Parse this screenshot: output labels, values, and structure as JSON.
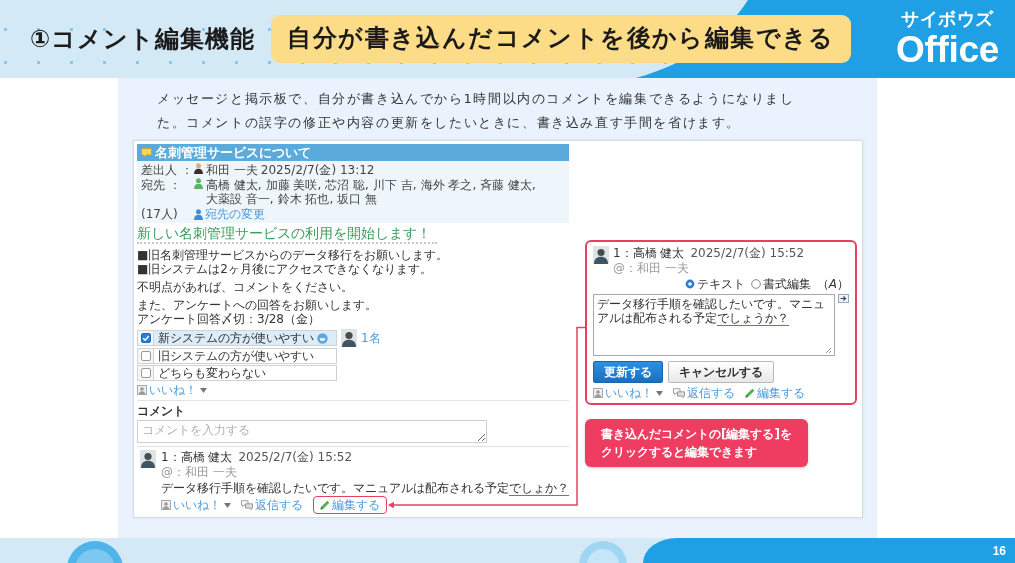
{
  "header": {
    "title": "①コメント編集機能",
    "headline": "自分が書き込んだコメントを後から編集できる",
    "logo": [
      "サイボウズ",
      "Office"
    ]
  },
  "intro": "メッセージと掲示板で、自分が書き込んでから1時間以内のコメントを編集できるようになりました。コメントの誤字の修正や内容の更新をしたいときに、書き込み直す手間を省けます。",
  "message": {
    "subject": "名刺管理サービスについて",
    "sender_label": "差出人 ：",
    "sender": "和田 一夫",
    "sent_at": "2025/2/7(金) 13:12",
    "recipients_label": "宛先 ：",
    "recipients": [
      "高橋 健太,",
      "加藤 美咲,",
      "芯沼 聡,",
      "川下 吉,",
      "海外 孝之,",
      "斉藤 健太,",
      "大薬設 音一,",
      "鈴木 拓也,",
      "坂口 無"
    ],
    "recipient_count": "(17人)",
    "change_recipients": "宛先の変更",
    "title": "新しい名刺管理サービスの利用を開始します！",
    "paragraphs": [
      [
        "■旧名刺管理サービスからのデータ移行をお願いします。",
        "■旧システムは2ヶ月後にアクセスできなくなります。"
      ],
      [
        "不明点があれば、コメントをください。"
      ],
      [
        "また、アンケートへの回答をお願いします。",
        "アンケート回答〆切：3/28（金）"
      ]
    ],
    "poll": [
      {
        "label": "新システムの方が使いやすい",
        "checked": true,
        "voters": "1名"
      },
      {
        "label": "旧システムの方が使いやすい",
        "checked": false
      },
      {
        "label": "どちらも変わらない",
        "checked": false
      }
    ],
    "like": "いいね！",
    "comment_heading": "コメント",
    "comment_placeholder": "コメントを入力する"
  },
  "comment": {
    "author": "1：高橋 健太",
    "posted_at": "2025/2/7(金) 15:52",
    "mention": "@：和田 一夫",
    "body": [
      {
        "text": "データ移行手順を確認したいです。マニュアルは配布される予定",
        "underlined": false
      },
      {
        "text": "でしょか？",
        "underlined": true
      }
    ],
    "actions": [
      {
        "kind": "like",
        "label": "いいね！",
        "highlighted": false
      },
      {
        "kind": "reply",
        "label": "返信する",
        "highlighted": false
      },
      {
        "kind": "edit",
        "label": "編集する",
        "highlighted": true
      }
    ]
  },
  "edit_panel": {
    "author": "1：高橋 健太",
    "posted_at": "2025/2/7(金) 15:52",
    "mention": "@：和田 一夫",
    "modes": [
      {
        "label": "テキスト",
        "selected": true
      },
      {
        "label": "書式編集",
        "selected": false
      }
    ],
    "format_mark": "（*A*）",
    "value": [
      {
        "text": "データ移行手順を確認したいです。マニュアルは配布される予定",
        "underlined": false
      },
      {
        "text": "でしょうか？",
        "underlined": true
      }
    ],
    "buttons": [
      {
        "kind": "primary",
        "label": "更新する"
      },
      {
        "kind": "secondary",
        "label": "キャンセルする"
      }
    ],
    "actions": [
      {
        "kind": "like",
        "label": "いいね！"
      },
      {
        "kind": "reply",
        "label": "返信する"
      },
      {
        "kind": "edit",
        "label": "編集する"
      }
    ]
  },
  "callout": [
    "書き込んだコメントの[編集する]を",
    "クリックすると編集できます"
  ],
  "page_number": "16"
}
